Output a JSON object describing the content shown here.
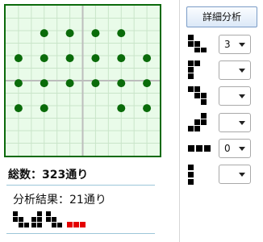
{
  "board": {
    "grid_size": 6,
    "pieces": [
      [
        1,
        2
      ],
      [
        1,
        3
      ],
      [
        1,
        4
      ],
      [
        1,
        5
      ],
      [
        2,
        1
      ],
      [
        2,
        2
      ],
      [
        2,
        3
      ],
      [
        2,
        4
      ],
      [
        2,
        5
      ],
      [
        2,
        6
      ],
      [
        3,
        1
      ],
      [
        3,
        2
      ],
      [
        3,
        3
      ],
      [
        3,
        4
      ],
      [
        3,
        5
      ],
      [
        3,
        6
      ],
      [
        4,
        1
      ],
      [
        4,
        2
      ],
      [
        4,
        5
      ],
      [
        4,
        6
      ]
    ],
    "colors": {
      "bg": "#e9fbe9",
      "grid": "#c9e5c9",
      "border": "#0b6a0b",
      "midline": "#bdbdbd",
      "piece": "#0a6b0a"
    }
  },
  "controls": {
    "analyze_label": "詳細分析",
    "rows": [
      {
        "icon": "tetromino-s-icon",
        "value": "3"
      },
      {
        "icon": "tetromino-l-icon",
        "value": ""
      },
      {
        "icon": "tetromino-z-icon",
        "value": ""
      },
      {
        "icon": "tetromino-j-icon",
        "value": ""
      },
      {
        "icon": "tromino-i-icon",
        "value": "0"
      },
      {
        "icon": "tetromino-i-icon",
        "value": ""
      }
    ]
  },
  "summary": {
    "total": "総数：323通り",
    "result": "分析結果：21通り"
  },
  "colors": {
    "accent_red": "#e40000",
    "black": "#000000"
  }
}
